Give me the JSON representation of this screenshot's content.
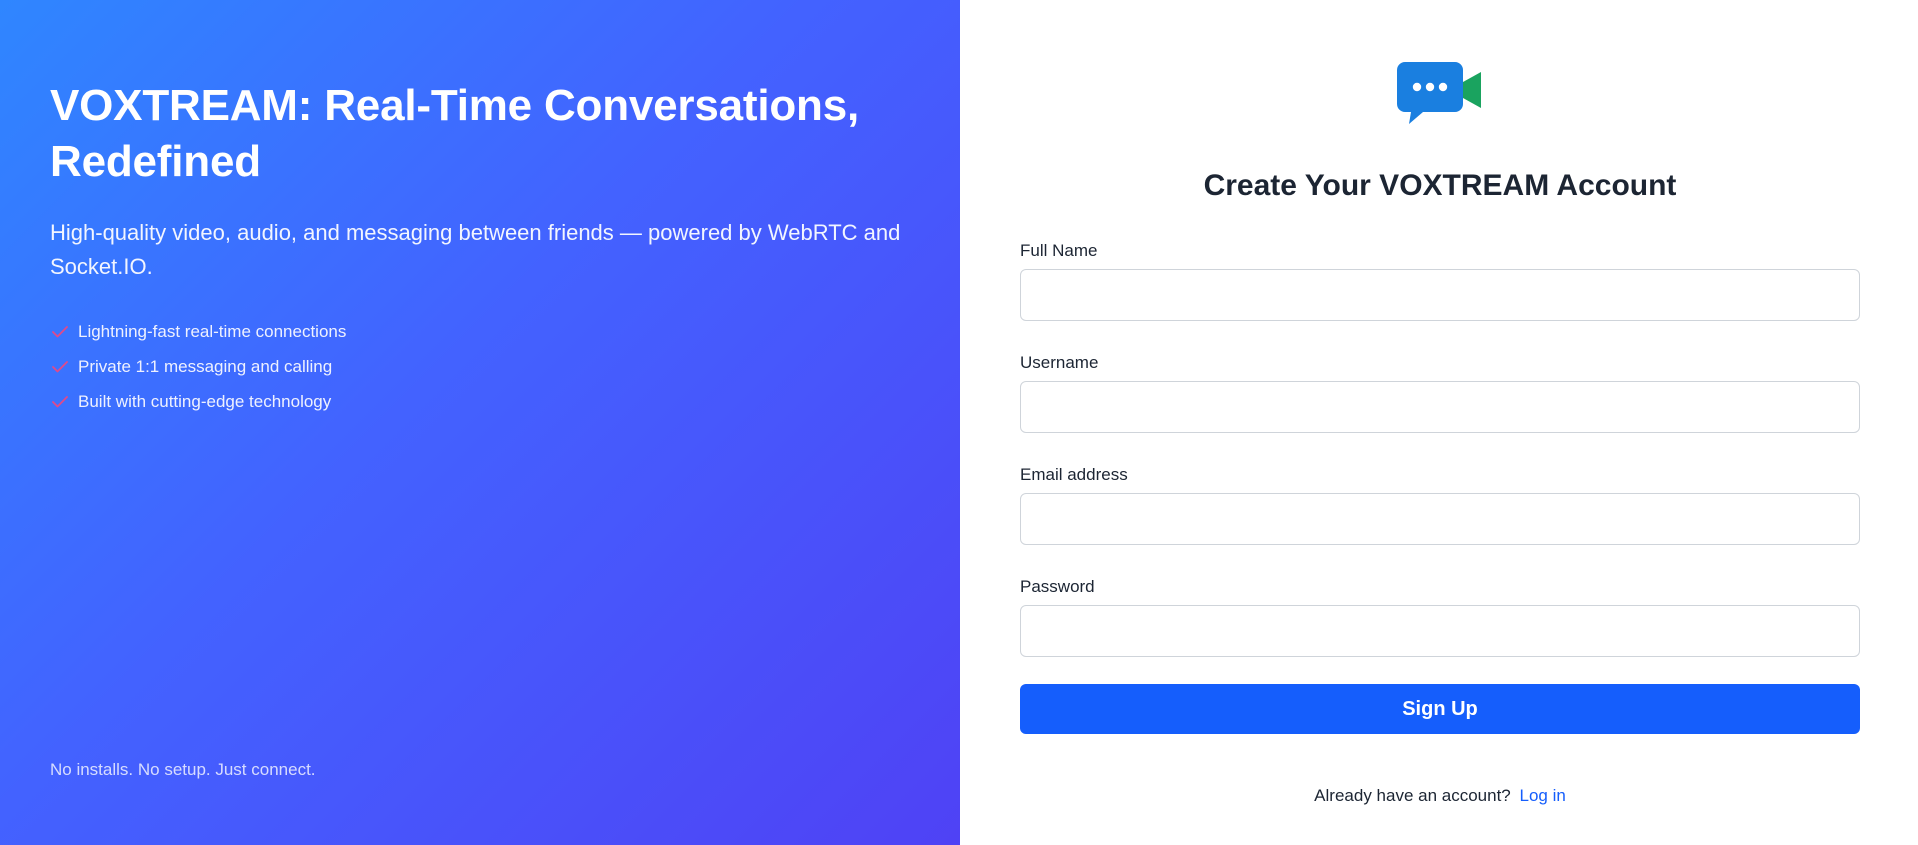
{
  "hero": {
    "title": "VOXTREAM: Real-Time Conversations, Redefined",
    "subtitle": "High-quality video, audio, and messaging between friends — powered by WebRTC and Socket.IO.",
    "features": [
      "Lightning-fast real-time connections",
      "Private 1:1 messaging and calling",
      "Built with cutting-edge technology"
    ],
    "footer": "No installs. No setup. Just connect.",
    "check_icon": "check-icon",
    "check_color": "#e04a8a",
    "gradient": [
      "#2f86ff",
      "#4f42f5"
    ]
  },
  "form": {
    "logo_icon": "chat-video-icon",
    "logo_colors": {
      "bubble": "#1a7fe0",
      "camera": "#1aa35f"
    },
    "title": "Create Your VOXTREAM Account",
    "fields": [
      {
        "label": "Full Name",
        "value": "",
        "placeholder": ""
      },
      {
        "label": "Username",
        "value": "",
        "placeholder": ""
      },
      {
        "label": "Email address",
        "value": "",
        "placeholder": ""
      },
      {
        "label": "Password",
        "value": "",
        "placeholder": ""
      }
    ],
    "submit_label": "Sign Up",
    "login_prompt": "Already have an account?",
    "login_link": "Log in",
    "accent": "#155efc"
  }
}
